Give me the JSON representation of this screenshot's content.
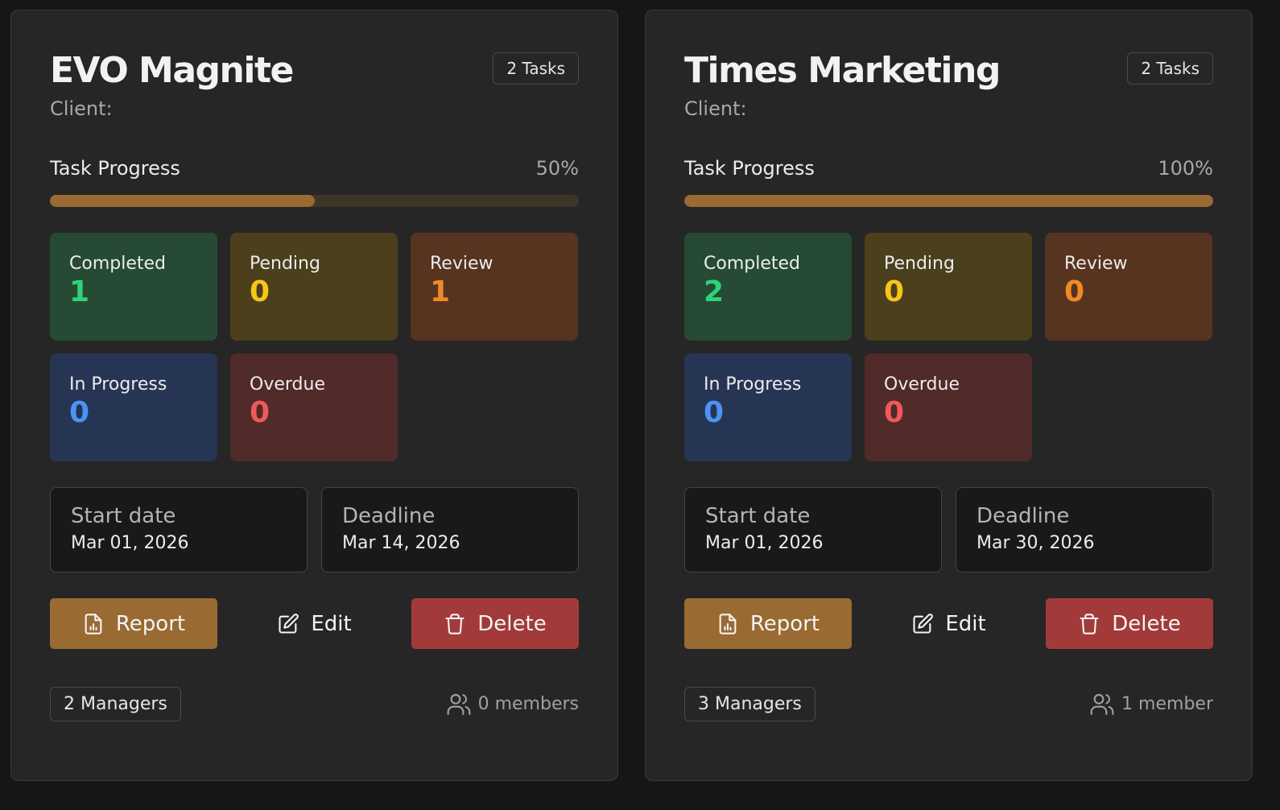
{
  "projects": [
    {
      "title": "EVO Magnite",
      "tasks_badge": "2 Tasks",
      "client_label": "Client:",
      "progress_label": "Task Progress",
      "progress_text": "50%",
      "progress": 0.5,
      "stats": {
        "completed": {
          "label": "Completed",
          "value": "1"
        },
        "pending": {
          "label": "Pending",
          "value": "0"
        },
        "review": {
          "label": "Review",
          "value": "1"
        },
        "in_progress": {
          "label": "In Progress",
          "value": "0"
        },
        "overdue": {
          "label": "Overdue",
          "value": "0"
        }
      },
      "start_label": "Start date",
      "start_date": "Mar 01, 2026",
      "deadline_label": "Deadline",
      "deadline": "Mar 14, 2026",
      "report_label": "Report",
      "edit_label": "Edit",
      "delete_label": "Delete",
      "managers_badge": "2 Managers",
      "members_text": "0 members"
    },
    {
      "title": "Times Marketing",
      "tasks_badge": "2 Tasks",
      "client_label": "Client:",
      "progress_label": "Task Progress",
      "progress_text": "100%",
      "progress": 1.0,
      "stats": {
        "completed": {
          "label": "Completed",
          "value": "2"
        },
        "pending": {
          "label": "Pending",
          "value": "0"
        },
        "review": {
          "label": "Review",
          "value": "0"
        },
        "in_progress": {
          "label": "In Progress",
          "value": "0"
        },
        "overdue": {
          "label": "Overdue",
          "value": "0"
        }
      },
      "start_label": "Start date",
      "start_date": "Mar 01, 2026",
      "deadline_label": "Deadline",
      "deadline": "Mar 30, 2026",
      "report_label": "Report",
      "edit_label": "Edit",
      "delete_label": "Delete",
      "managers_badge": "3 Managers",
      "members_text": "1 member"
    }
  ],
  "colors": {
    "accent": "#996a32",
    "danger": "#a23a3a",
    "completed": "#2ed47a",
    "pending": "#f5c518",
    "review": "#f08a24",
    "in_progress": "#4c93f5",
    "overdue": "#f0585a"
  },
  "icons": {
    "report": "report-document-icon",
    "edit": "edit-pencil-icon",
    "delete": "trash-icon",
    "members": "users-icon"
  }
}
